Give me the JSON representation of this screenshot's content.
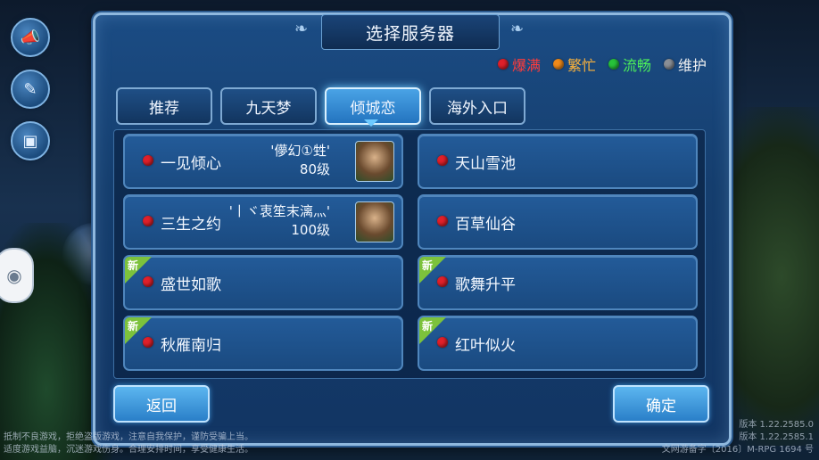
{
  "dialog": {
    "title": "选择服务器"
  },
  "legend": [
    {
      "label": "爆满",
      "color": "#e0202a",
      "text_color": "#ff3b3b"
    },
    {
      "label": "繁忙",
      "color": "#f08a1a",
      "text_color": "#ffb43a"
    },
    {
      "label": "流畅",
      "color": "#27c23a",
      "text_color": "#4cf05a"
    },
    {
      "label": "维护",
      "color": "#8a8f96",
      "text_color": "#f2f2f2"
    }
  ],
  "tabs": [
    {
      "label": "推荐",
      "active": false
    },
    {
      "label": "九天梦",
      "active": false
    },
    {
      "label": "倾城恋",
      "active": true
    },
    {
      "label": "海外入口",
      "active": false
    }
  ],
  "servers": [
    {
      "name": "一见倾心",
      "status": "爆满",
      "role": "'儚幻①甡'",
      "level": "80级",
      "new": false
    },
    {
      "name": "天山雪池",
      "status": "爆满",
      "new": false
    },
    {
      "name": "三生之约",
      "status": "爆满",
      "role": "'丨ヾ衷笙末漓灬'",
      "level": "100级",
      "new": false
    },
    {
      "name": "百草仙谷",
      "status": "爆满",
      "new": false
    },
    {
      "name": "盛世如歌",
      "status": "爆满",
      "new": true
    },
    {
      "name": "歌舞升平",
      "status": "爆满",
      "new": true
    },
    {
      "name": "秋雁南归",
      "status": "爆满",
      "new": true
    },
    {
      "name": "红叶似火",
      "status": "爆满",
      "new": true
    }
  ],
  "new_badge": "新",
  "buttons": {
    "back": "返回",
    "confirm": "确定"
  },
  "footer": {
    "left_line1": "抵制不良游戏，拒绝盗版游戏，注意自我保护，谨防受骗上当。",
    "left_line2": "适度游戏益脑，沉迷游戏伤身。合理安排时间，享受健康生活。",
    "right_line1": "版本 1.22.2585.0",
    "right_line2": "版本 1.22.2585.1",
    "right_line3": "文网游备字〔2016〕M-RPG 1694 号"
  },
  "icons": [
    "speaker-icon",
    "notes-icon",
    "scan-icon",
    "gamepad-icon"
  ]
}
